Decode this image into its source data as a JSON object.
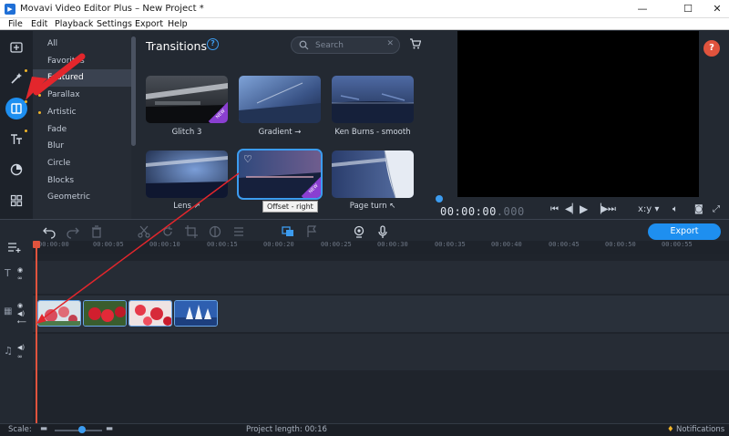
{
  "window": {
    "title": "Movavi Video Editor Plus – New Project *"
  },
  "menu": [
    "File",
    "Edit",
    "Playback",
    "Settings",
    "Export",
    "Help"
  ],
  "rail": {
    "icons": [
      "import-icon",
      "magic-wand-icon",
      "transitions-icon",
      "titles-icon",
      "filters-icon",
      "more-tools-icon"
    ],
    "active": "transitions-icon"
  },
  "categories": {
    "items": [
      "All",
      "Favorites",
      "Featured",
      "Parallax",
      "Artistic",
      "Fade",
      "Blur",
      "Circle",
      "Blocks",
      "Geometric"
    ],
    "selected": "Featured",
    "dotted": [
      "Parallax",
      "Artistic"
    ]
  },
  "panel": {
    "title": "Transitions",
    "search_placeholder": "Search",
    "tiles": [
      {
        "label": "Glitch 3",
        "new": true,
        "badge": "NEW"
      },
      {
        "label": "Gradient →",
        "new": false
      },
      {
        "label": "Ken Burns - smooth",
        "new": false
      },
      {
        "label": "Lens ↗",
        "new": false
      },
      {
        "label": "",
        "new": true,
        "badge": "NEW",
        "selected": true
      },
      {
        "label": "Page turn ↖",
        "new": false
      }
    ],
    "tooltip": "Offset - right"
  },
  "player": {
    "timecode_main": "00:00:00",
    "timecode_frac": ".000",
    "aspect_label": "x:y"
  },
  "toolbar": {
    "export_label": "Export"
  },
  "ruler": [
    "00:00:00",
    "00:00:05",
    "00:00:10",
    "00:00:15",
    "00:00:20",
    "00:00:25",
    "00:00:30",
    "00:00:35",
    "00:00:40",
    "00:00:45",
    "00:00:50",
    "00:00:55"
  ],
  "status": {
    "scale_label": "Scale:",
    "project_length": "Project length:  00:16",
    "notifications": "Notifications"
  },
  "colors": {
    "accent": "#1e8ff0",
    "highlight": "#e0533d",
    "new_badge": "#8a3fd1"
  }
}
